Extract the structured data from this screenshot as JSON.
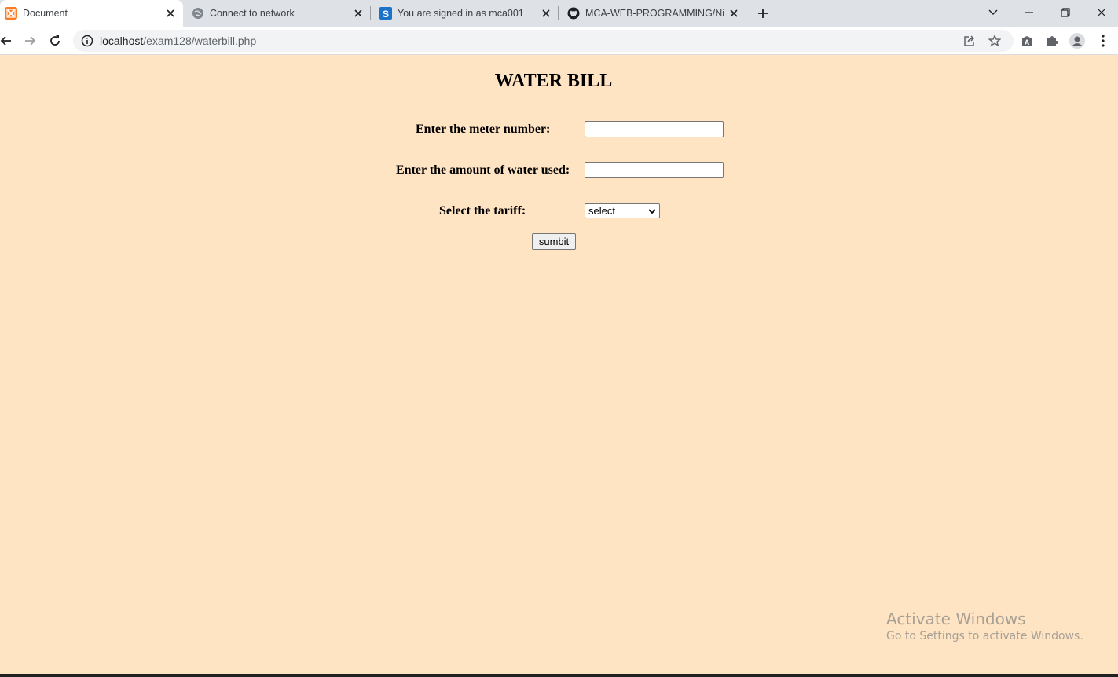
{
  "browser": {
    "tabs": [
      {
        "title": "Document",
        "icon": "xampp-icon",
        "active": true
      },
      {
        "title": "Connect to network",
        "icon": "globe-icon",
        "active": false
      },
      {
        "title": "You are signed in as mca001",
        "icon": "s-logo-icon",
        "active": false
      },
      {
        "title": "MCA-WEB-PROGRAMMING/Niki",
        "icon": "github-icon",
        "active": false
      }
    ],
    "url_host": "localhost",
    "url_path": "/exam128/waterbill.php"
  },
  "page": {
    "title": "WATER BILL",
    "form": {
      "meter_label": "Enter the meter number:",
      "meter_value": "",
      "water_label": "Enter the amount of water used:",
      "water_value": "",
      "tariff_label": "Select the tariff:",
      "tariff_selected": "select",
      "submit_label": "sumbit"
    },
    "background_color": "#ffe4c4"
  },
  "watermark": {
    "line1": "Activate Windows",
    "line2": "Go to Settings to activate Windows."
  }
}
